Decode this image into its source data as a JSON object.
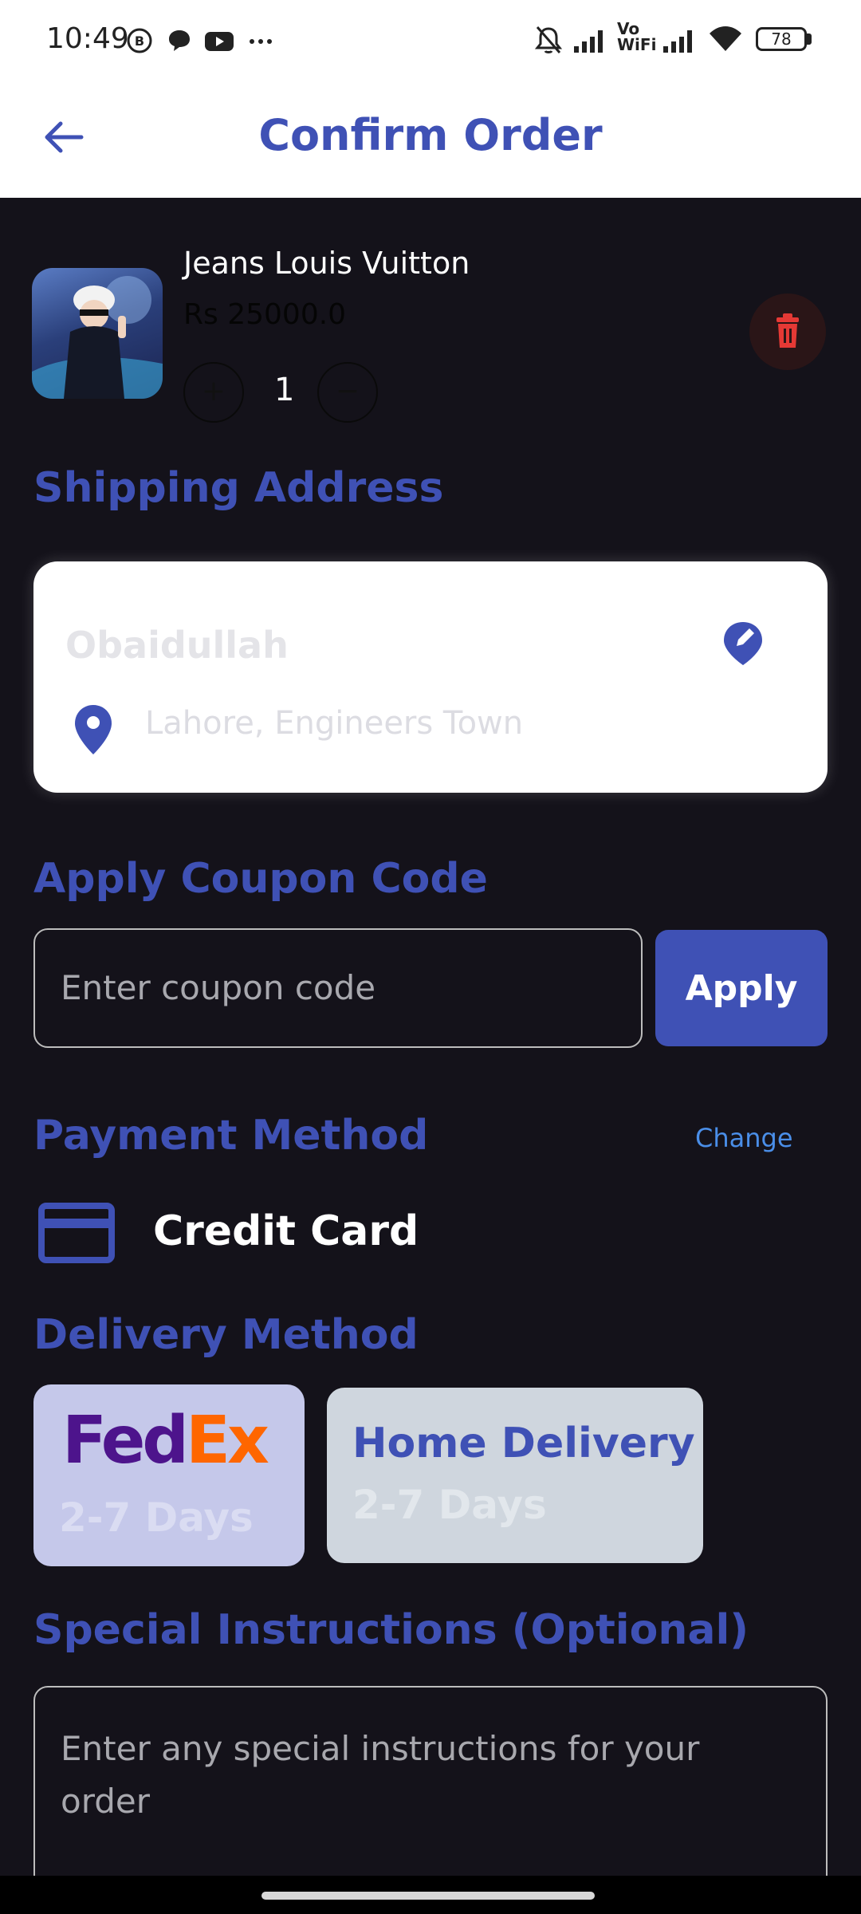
{
  "status": {
    "time": "10:49",
    "battery": "78",
    "network_vo": "Vo",
    "network_wifi": "WiFi"
  },
  "appbar": {
    "title": "Confirm Order"
  },
  "cart_item": {
    "name": "Jeans Louis Vuitton",
    "price": "Rs 25000.0",
    "quantity": "1",
    "plus_symbol": "+",
    "minus_symbol": "−"
  },
  "shipping": {
    "title": "Shipping Address",
    "name": "Obaidullah",
    "address": "Lahore, Engineers Town"
  },
  "coupon": {
    "title": "Apply Coupon Code",
    "placeholder": "Enter coupon code",
    "apply_label": "Apply"
  },
  "payment": {
    "title": "Payment Method",
    "change_label": "Change",
    "method": "Credit Card"
  },
  "delivery": {
    "title": "Delivery Method",
    "options": [
      {
        "logo_text_fed": "Fed",
        "logo_text_ex": "Ex",
        "days": "2-7 Days"
      },
      {
        "name": "Home Delivery",
        "days": "2-7 Days"
      }
    ]
  },
  "instructions": {
    "title": "Special Instructions (Optional)",
    "placeholder": "Enter any special instructions for your order"
  },
  "colors": {
    "accent": "#3f51b5",
    "background": "#14121a",
    "delete_red": "#e53935",
    "fedex_purple": "#4d148c",
    "fedex_orange": "#ff6600"
  }
}
